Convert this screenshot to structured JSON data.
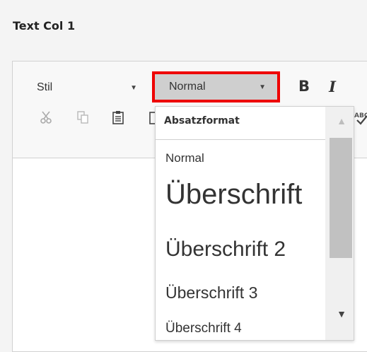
{
  "field": {
    "label": "Text Col 1"
  },
  "toolbar": {
    "style_combo": {
      "label": "Stil"
    },
    "format_combo": {
      "label": "Normal"
    },
    "bold_label": "B",
    "italic_label": "I",
    "icons": [
      "cut-icon",
      "copy-icon",
      "paste-icon",
      "paste-text-icon",
      "spellcheck-icon"
    ]
  },
  "dropdown": {
    "header": "Absatzformat",
    "items": [
      "Normal",
      "Überschrift",
      "Überschrift 2",
      "Überschrift 3",
      "Überschrift 4"
    ]
  },
  "colors": {
    "highlight": "#ee0000",
    "combo_bg": "#cfcfcf"
  }
}
